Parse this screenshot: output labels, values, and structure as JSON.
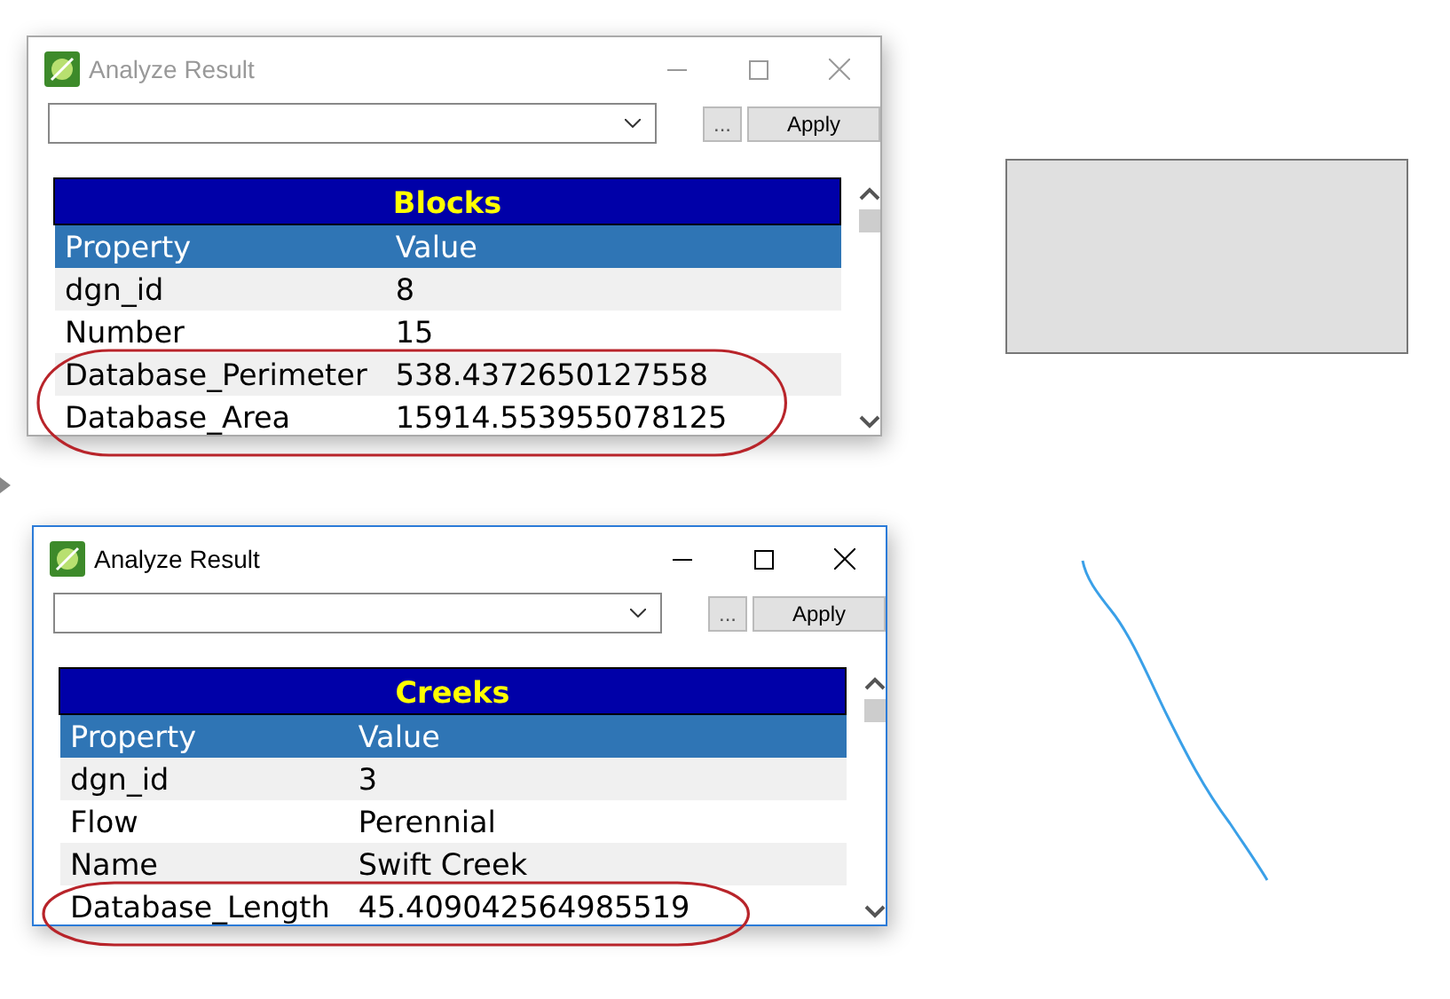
{
  "windows": [
    {
      "title": "Analyze Result",
      "active": false,
      "buttons": [
        "...",
        "Apply"
      ],
      "table": {
        "title": "Blocks",
        "columns": [
          "Property",
          "Value"
        ],
        "rows": [
          {
            "property": "dgn_id",
            "value": "8",
            "circled": false
          },
          {
            "property": "Number",
            "value": "15",
            "circled": false
          },
          {
            "property": "Database_Perimeter",
            "value": "538.4372650127558",
            "circled": true
          },
          {
            "property": "Database_Area",
            "value": "15914.553955078125",
            "circled": true
          }
        ]
      }
    },
    {
      "title": "Analyze Result",
      "active": true,
      "buttons": [
        "...",
        "Apply"
      ],
      "table": {
        "title": "Creeks",
        "columns": [
          "Property",
          "Value"
        ],
        "rows": [
          {
            "property": "dgn_id",
            "value": "3",
            "circled": false
          },
          {
            "property": "Flow",
            "value": "Perennial",
            "circled": false
          },
          {
            "property": "Name",
            "value": "Swift Creek",
            "circled": false
          },
          {
            "property": "Database_Length",
            "value": "45.409042564985519",
            "circled": true
          }
        ]
      }
    }
  ]
}
